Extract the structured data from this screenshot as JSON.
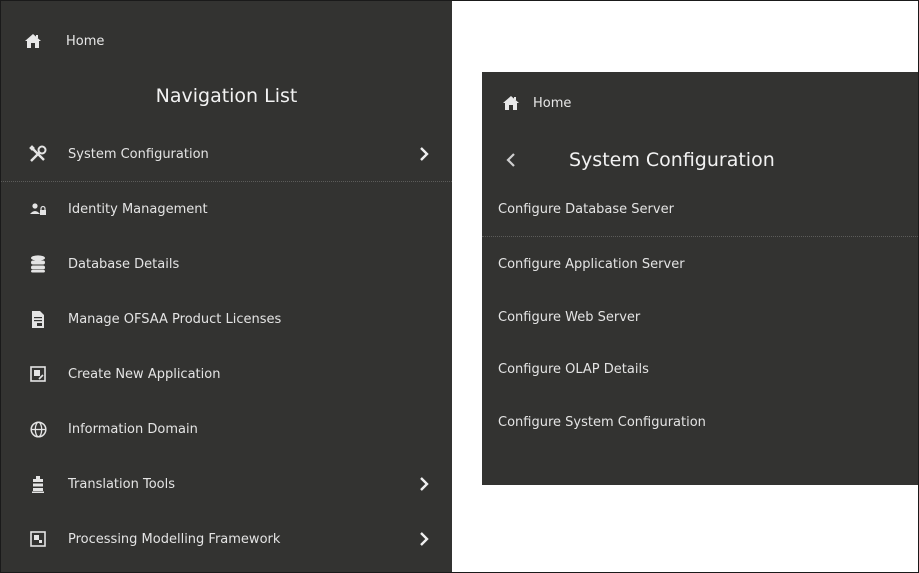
{
  "nav": {
    "home_label": "Home",
    "title": "Navigation List",
    "items": [
      {
        "label": "System Configuration",
        "icon": "tools-icon",
        "has_submenu": true
      },
      {
        "label": "Identity Management",
        "icon": "users-lock-icon",
        "has_submenu": false
      },
      {
        "label": "Database Details",
        "icon": "database-icon",
        "has_submenu": false
      },
      {
        "label": "Manage OFSAA Product Licenses",
        "icon": "license-document-icon",
        "has_submenu": false
      },
      {
        "label": "Create New Application",
        "icon": "new-application-icon",
        "has_submenu": false
      },
      {
        "label": "Information Domain",
        "icon": "globe-icon",
        "has_submenu": false
      },
      {
        "label": "Translation Tools",
        "icon": "translation-tools-icon",
        "has_submenu": true
      },
      {
        "label": "Processing Modelling Framework",
        "icon": "framework-icon",
        "has_submenu": true
      }
    ]
  },
  "submenu": {
    "home_label": "Home",
    "title": "System Configuration",
    "items": [
      {
        "label": "Configure Database Server"
      },
      {
        "label": "Configure Application Server"
      },
      {
        "label": "Configure Web Server"
      },
      {
        "label": "Configure OLAP Details"
      },
      {
        "label": "Configure System Configuration"
      }
    ]
  },
  "colors": {
    "panel_bg": "#333331",
    "text": "#e4e4e4",
    "page_bg": "#ffffff"
  }
}
